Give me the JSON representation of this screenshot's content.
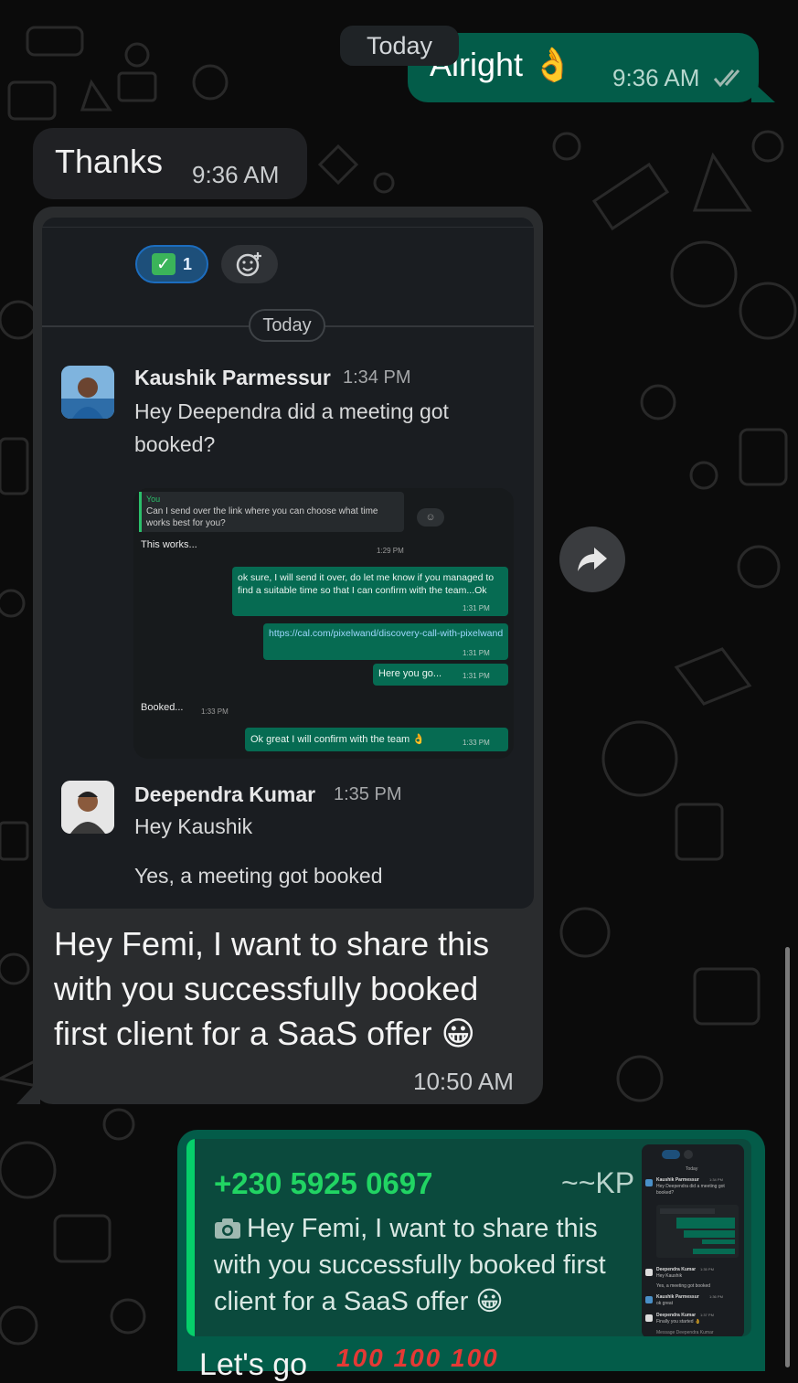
{
  "date_chip": "Today",
  "messages": {
    "alright": {
      "text": "Alright 👌",
      "time": "9:36 AM"
    },
    "thanks": {
      "text": "Thanks",
      "time": "9:36 AM"
    },
    "forwarded_image": {
      "reaction_count": "1",
      "today_label": "Today",
      "posts": [
        {
          "sender": "Kaushik Parmessur",
          "time": "1:34 PM",
          "text": "Hey Deependra did a meeting got booked?"
        },
        {
          "sender": "Deependra Kumar",
          "time": "1:35 PM",
          "text": "Hey Kaushik",
          "text2": "Yes, a meeting got booked"
        }
      ],
      "inner_chat": {
        "you_label": "You",
        "q1": "Can I send over the link where you can choose what time works best for you?",
        "m1": "This works...",
        "m1_time": "1:29 PM",
        "m2": "ok sure, I will send it over, do let me know if you managed to find a suitable time so that I can confirm with the team...Ok",
        "m2_time": "1:31 PM",
        "m3": "https://cal.com/pixelwand/discovery-call-with-pixelwand",
        "m3_time": "1:31 PM",
        "m4": "Here you go...",
        "m4_time": "1:31 PM",
        "m5": "Booked...",
        "m5_time": "1:33 PM",
        "m6": "Ok great I will confirm with the team 👌",
        "m6_time": "1:33 PM"
      },
      "caption": "Hey Femi, I want to share this with you successfully booked first client for a SaaS offer 😀",
      "time": "10:50 AM"
    },
    "reply": {
      "quoted_phone": "+230 5925 0697",
      "quoted_name": "~~KP",
      "quoted_text": "Hey Femi, I want to share this with you successfully booked first client for a SaaS offer 😀",
      "text": "Let's go",
      "emojis": "100 100 100"
    }
  },
  "thumb": {
    "today": "Today",
    "p1_name": "Kaushik Parmessur",
    "p1_time": "1:34 PM",
    "p1_text": "Hey Deependra did a meeting got booked?",
    "p2_name": "Deependra Kumar",
    "p2_time": "1:35 PM",
    "p2_text": "Hey Kaushik",
    "p2_text2": "Yes, a meeting got booked",
    "p3_name": "Kaushik Parmessur",
    "p3_time": "1:36 PM",
    "p3_text": "ok great",
    "p4_name": "Deependra Kumar",
    "p4_time": "1:37 PM",
    "p4_text": "Finally you started 👌",
    "input": "Message Deependra Kumar"
  }
}
